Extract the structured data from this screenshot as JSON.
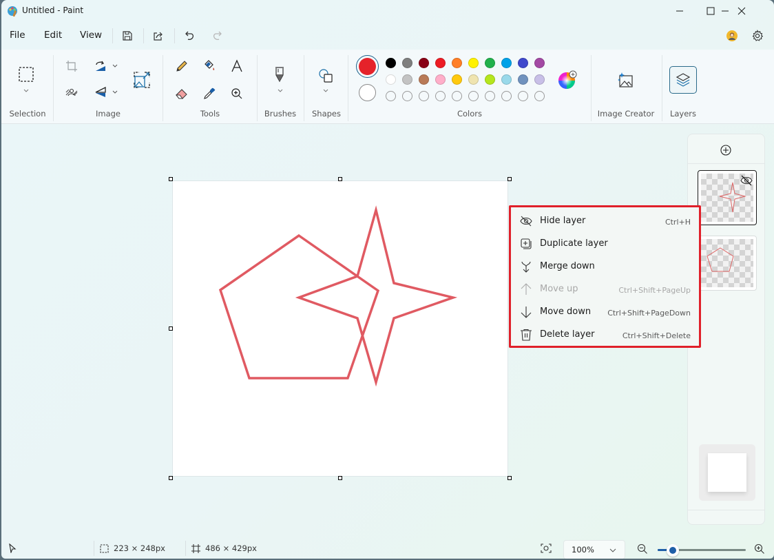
{
  "window": {
    "title": "Untitled - Paint"
  },
  "menubar": {
    "items": [
      {
        "label": "File"
      },
      {
        "label": "Edit"
      },
      {
        "label": "View"
      }
    ],
    "quick_actions": [
      "save-icon",
      "share-icon",
      "undo-icon",
      "redo-icon"
    ]
  },
  "ribbon": {
    "groups": {
      "selection": "Selection",
      "image": "Image",
      "tools": "Tools",
      "brushes": "Brushes",
      "shapes": "Shapes",
      "colors": "Colors",
      "image_creator": "Image Creator",
      "layers": "Layers"
    },
    "colors": {
      "primary": "#e5222a",
      "secondary": "#ffffff",
      "row1": [
        "#000000",
        "#7f7f7f",
        "#880015",
        "#ed1c24",
        "#ff7f27",
        "#fff200",
        "#22b14c",
        "#00a2e8",
        "#3f48cc",
        "#a349a4"
      ],
      "row2": [
        "#ffffff",
        "#c3c3c3",
        "#b97a57",
        "#ffaec9",
        "#ffc90e",
        "#efe4b0",
        "#b5e61d",
        "#99d9ea",
        "#7092be",
        "#c8bfe7"
      ],
      "row3_empty_count": 10
    }
  },
  "context_menu": {
    "items": [
      {
        "label": "Hide layer",
        "shortcut": "Ctrl+H",
        "icon": "eye-off-icon",
        "disabled": false
      },
      {
        "label": "Duplicate layer",
        "shortcut": "",
        "icon": "duplicate-icon",
        "disabled": false
      },
      {
        "label": "Merge down",
        "shortcut": "",
        "icon": "merge-down-icon",
        "disabled": false
      },
      {
        "label": "Move up",
        "shortcut": "Ctrl+Shift+PageUp",
        "icon": "arrow-up-icon",
        "disabled": true
      },
      {
        "label": "Move down",
        "shortcut": "Ctrl+Shift+PageDown",
        "icon": "arrow-down-icon",
        "disabled": false
      },
      {
        "label": "Delete layer",
        "shortcut": "Ctrl+Shift+Delete",
        "icon": "trash-icon",
        "disabled": false
      }
    ]
  },
  "layers_panel": {
    "layers": [
      {
        "name": "star-layer",
        "hidden": true,
        "selected": true
      },
      {
        "name": "pentagon-layer",
        "hidden": false,
        "selected": false
      },
      {
        "name": "background-layer",
        "hidden": false,
        "selected": false
      }
    ]
  },
  "canvas": {
    "stroke_color": "#e05a62"
  },
  "statusbar": {
    "selection_size": "223 × 248px",
    "canvas_size": "486 × 429px",
    "zoom_value": "100%",
    "zoom_slider_fraction": 0.17
  }
}
